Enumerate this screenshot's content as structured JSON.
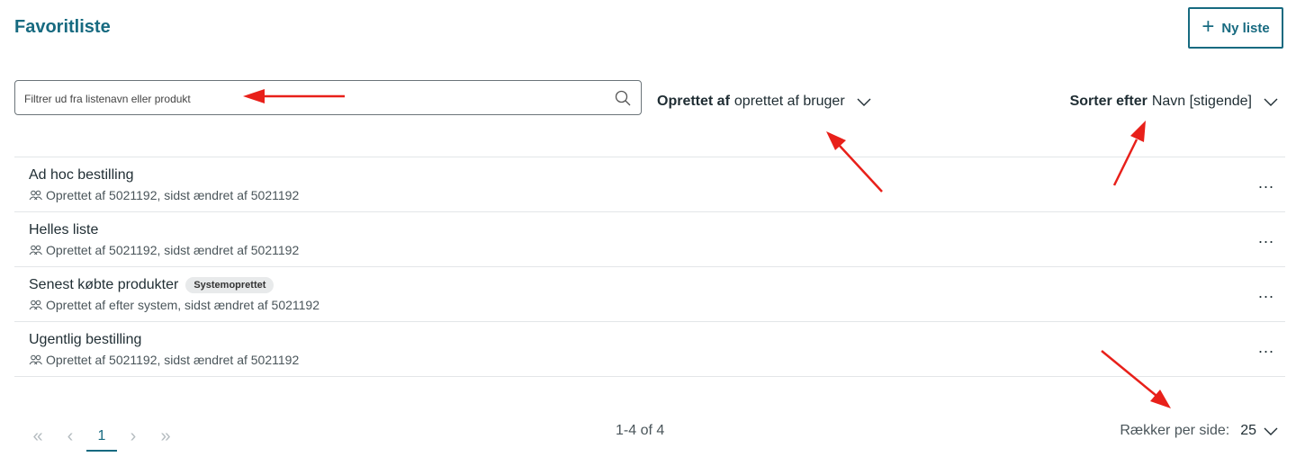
{
  "header": {
    "title": "Favoritliste",
    "new_list_label": "Ny liste"
  },
  "filter": {
    "placeholder": "Filtrer ud fra listenavn eller produkt",
    "value": ""
  },
  "created_by": {
    "label": "Oprettet af",
    "value": "oprettet af bruger"
  },
  "sort": {
    "label": "Sorter efter",
    "value": "Navn [stigende]"
  },
  "lists": [
    {
      "name": "Ad hoc bestilling",
      "badge": "",
      "meta": "Oprettet af 5021192, sidst ændret af 5021192"
    },
    {
      "name": "Helles liste",
      "badge": "",
      "meta": "Oprettet af 5021192, sidst ændret af 5021192"
    },
    {
      "name": "Senest købte produkter",
      "badge": "Systemoprettet",
      "meta": "Oprettet af efter system, sidst ændret af 5021192"
    },
    {
      "name": "Ugentlig bestilling",
      "badge": "",
      "meta": "Oprettet af 5021192, sidst ændret af 5021192"
    }
  ],
  "more_label": "...",
  "pagination": {
    "first": "«",
    "prev": "‹",
    "current": "1",
    "next": "›",
    "last": "»",
    "range": "1-4 of 4",
    "rows_per_page_label": "Rækker per side:",
    "rows_per_page_value": "25"
  },
  "colors": {
    "accent": "#176a80",
    "annotation": "#e8201a"
  }
}
